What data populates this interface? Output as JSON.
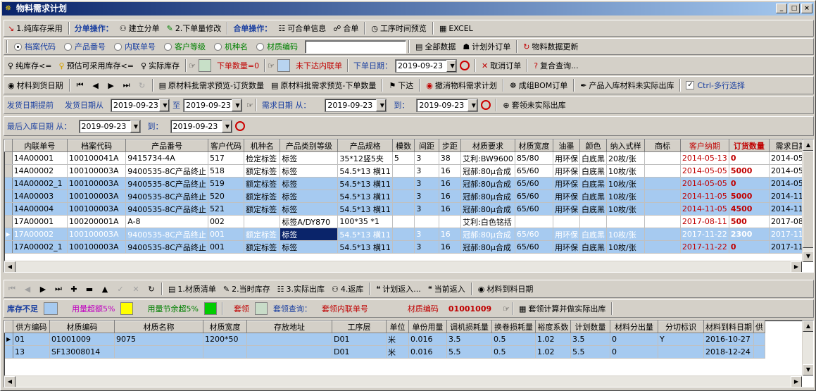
{
  "window": {
    "title": "物料需求计划",
    "controls": [
      "_",
      "□",
      "×"
    ]
  },
  "toolbar1": {
    "btn_pure_stock": "1.纯库存采用",
    "split_ops": "分单操作：",
    "btn_build_split": "建立分单",
    "btn_modify_qty": "2.下单量修改",
    "merge_ops": "合单操作：",
    "btn_mergeable_info": "可合单信息",
    "btn_merge": "合单",
    "btn_process_time": "工序时间预览",
    "btn_excel": "EXCEL"
  },
  "toolbar2": {
    "radios": [
      "档案代码",
      "产品番号",
      "内联单号",
      "客户等级",
      "机种名",
      "材质编码"
    ],
    "search_value": "",
    "btn_all_data": "全部数据",
    "btn_plan_extra": "计划外订单",
    "btn_update_material": "物料数据更新"
  },
  "toolbar3": {
    "flag_pure_stock": "纯库存<=",
    "flag_estimate": "预估可采用库存<=",
    "flag_actual": "实际库存",
    "lbl_qty_zero": "下单数量=0",
    "lbl_not_issued": "未下达内联单",
    "lbl_order_date": "下单日期：",
    "order_date": "2019-09-23",
    "btn_cancel_order": "取消订单",
    "btn_compound": "复合查询..."
  },
  "toolbar4": {
    "btn_arrival_date": "材料到货日期",
    "btn_batch_preview_order": "原材料批需求预览-订货数量",
    "btn_batch_preview_place": "原材料批需求预览-下单数量",
    "btn_issue": "下达",
    "btn_cancel_plan": "撤消物料需求计划",
    "btn_bom_order": "成组BOM订单",
    "btn_product_stock": "产品入库材料未实际出库",
    "cb_multi_select": "Ctrl-多行选择"
  },
  "toolbar5": {
    "lbl_ship_advance": "发货日期提前",
    "lbl_ship_from": "发货日期从",
    "ship_from": "2019-09-23",
    "lbl_to": "至",
    "ship_to": "2019-09-23",
    "lbl_demand_from": "需求日期 从：",
    "demand_from": "2019-09-23",
    "lbl_to2": "到：",
    "demand_to": "2019-09-23",
    "btn_set_not_out": "套领未实际出库"
  },
  "toolbar6": {
    "lbl_last_in": "最后入库日期 从：",
    "last_from": "2019-09-23",
    "lbl_to": "到：",
    "last_to": "2019-09-23"
  },
  "grid1": {
    "columns": [
      "内联单号",
      "档案代码",
      "产品番号",
      "客户代码",
      "机种名",
      "产品类别等级",
      "产品规格",
      "模数",
      "间距",
      "步距",
      "材质要求",
      "材质宽度",
      "油墨",
      "颜色",
      "纳入式样",
      "商标",
      "客户纳期",
      "订货数量",
      "需求日期"
    ],
    "rows": [
      [
        "14A00001",
        "100100041A",
        "9415734-4A",
        "517",
        "检定标签",
        "标签",
        "35*12竖5夹",
        "5",
        "3",
        "38",
        "艾利:BW9600",
        "85/80",
        "用环保",
        "白底黑",
        "20枚/张",
        "",
        "2014-05-13",
        "0",
        "2014-05-1"
      ],
      [
        "14A00002",
        "100100003A",
        "9400535-8C产品终止",
        "518",
        "额定标签",
        "标签",
        "54.5*13 横11",
        "",
        "3",
        "16",
        "冠郝:80μ合成",
        "65/60",
        "用环保",
        "白底黑",
        "10枚/张",
        "",
        "2014-05-05",
        "5000",
        "2014-05-0"
      ],
      [
        "14A00002_1",
        "100100003A",
        "9400535-8C产品终止",
        "519",
        "额定标签",
        "标签",
        "54.5*13 横11",
        "",
        "3",
        "16",
        "冠郝:80μ合成",
        "65/60",
        "用环保",
        "白底黑",
        "10枚/张",
        "",
        "2014-05-05",
        "0",
        "2014-05-0"
      ],
      [
        "14A00003",
        "100100003A",
        "9400535-8C产品终止",
        "520",
        "额定标签",
        "标签",
        "54.5*13 横11",
        "",
        "3",
        "16",
        "冠郝:80μ合成",
        "65/60",
        "用环保",
        "白底黑",
        "10枚/张",
        "",
        "2014-11-05",
        "5000",
        "2014-11-0"
      ],
      [
        "14A00004",
        "100100003A",
        "9400535-8C产品终止",
        "521",
        "额定标签",
        "标签",
        "54.5*13 横11",
        "",
        "3",
        "16",
        "冠郝:80μ合成",
        "65/60",
        "用环保",
        "白底黑",
        "10枚/张",
        "",
        "2014-11-05",
        "4500",
        "2014-11-0"
      ],
      [
        "17A00001",
        "100200001A",
        "A-8",
        "002",
        "",
        "标签A/DY870",
        "100*35 *1",
        "",
        "",
        "",
        "艾利:白色铭括",
        "",
        "",
        "",
        "",
        "",
        "2017-08-11",
        "500",
        "2017-08-1"
      ],
      [
        "17A00002",
        "100100003A",
        "9400535-8C产品终止",
        "001",
        "额定标签",
        "标签",
        "54.5*13 横11",
        "",
        "3",
        "16",
        "冠郝:80μ合成",
        "65/60",
        "用环保",
        "白底黑",
        "10枚/张",
        "",
        "2017-11-22",
        "2300",
        "2017-11-2"
      ],
      [
        "17A00002_1",
        "100100003A",
        "9400535-8C产品终止",
        "001",
        "额定标签",
        "标签",
        "54.5*13 横11",
        "",
        "3",
        "16",
        "冠郝:80μ合成",
        "65/60",
        "用环保",
        "白底黑",
        "10枚/张",
        "",
        "2017-11-22",
        "0",
        "2017-11-2"
      ]
    ]
  },
  "navbar": {
    "btn_materials": "1.材质清单",
    "btn_current_stock": "2.当时库存",
    "btn_actual_out": "3.实际出库",
    "btn_return": "4.返库",
    "btn_plan_in": "计划返入...",
    "btn_current_in": "当前返入",
    "btn_material_date": "材料到料日期"
  },
  "legend": {
    "stock_short": "库存不足",
    "over_qty": "用量超额5%",
    "saving_qty": "用量节余超5%",
    "set_claim": "套领",
    "set_query": "套领查询：",
    "set_inline": "套领内联单号",
    "mat_code_lbl": "材质编码",
    "mat_code": "01001009",
    "btn_set_calc": "套领计算并做实际出库"
  },
  "grid2": {
    "columns": [
      "供方编码",
      "材质编码",
      "材质名称",
      "材质宽度",
      "存放地址",
      "工序层",
      "单位",
      "单份用量",
      "调机损耗量",
      "换卷损耗量",
      "裕度系数",
      "计划数量",
      "材料分出量",
      "分切标识",
      "材料到料日期",
      "供"
    ],
    "rows": [
      [
        "01",
        "01001009",
        "9075",
        "1200*50",
        "",
        "D01",
        "米",
        "0.016",
        "3.5",
        "0.5",
        "1.02",
        "3.5",
        "0",
        "Y",
        "2016-10-27",
        ""
      ],
      [
        "13",
        "SF13008014",
        "",
        "",
        "",
        "D01",
        "米",
        "0.016",
        "5.5",
        "0.5",
        "1.02",
        "5.5",
        "0",
        "",
        "2018-12-24",
        ""
      ]
    ]
  },
  "colors": {
    "stock_short": "#a6caf0",
    "over_qty": "#ffff00",
    "saving_qty": "#00cc00",
    "set_claim": "#c8dcc8",
    "qty_zero": "#c8e0c8",
    "not_issued": "#b8d4f0",
    "title_start": "#0a246a",
    "title_end": "#a6caf0"
  }
}
